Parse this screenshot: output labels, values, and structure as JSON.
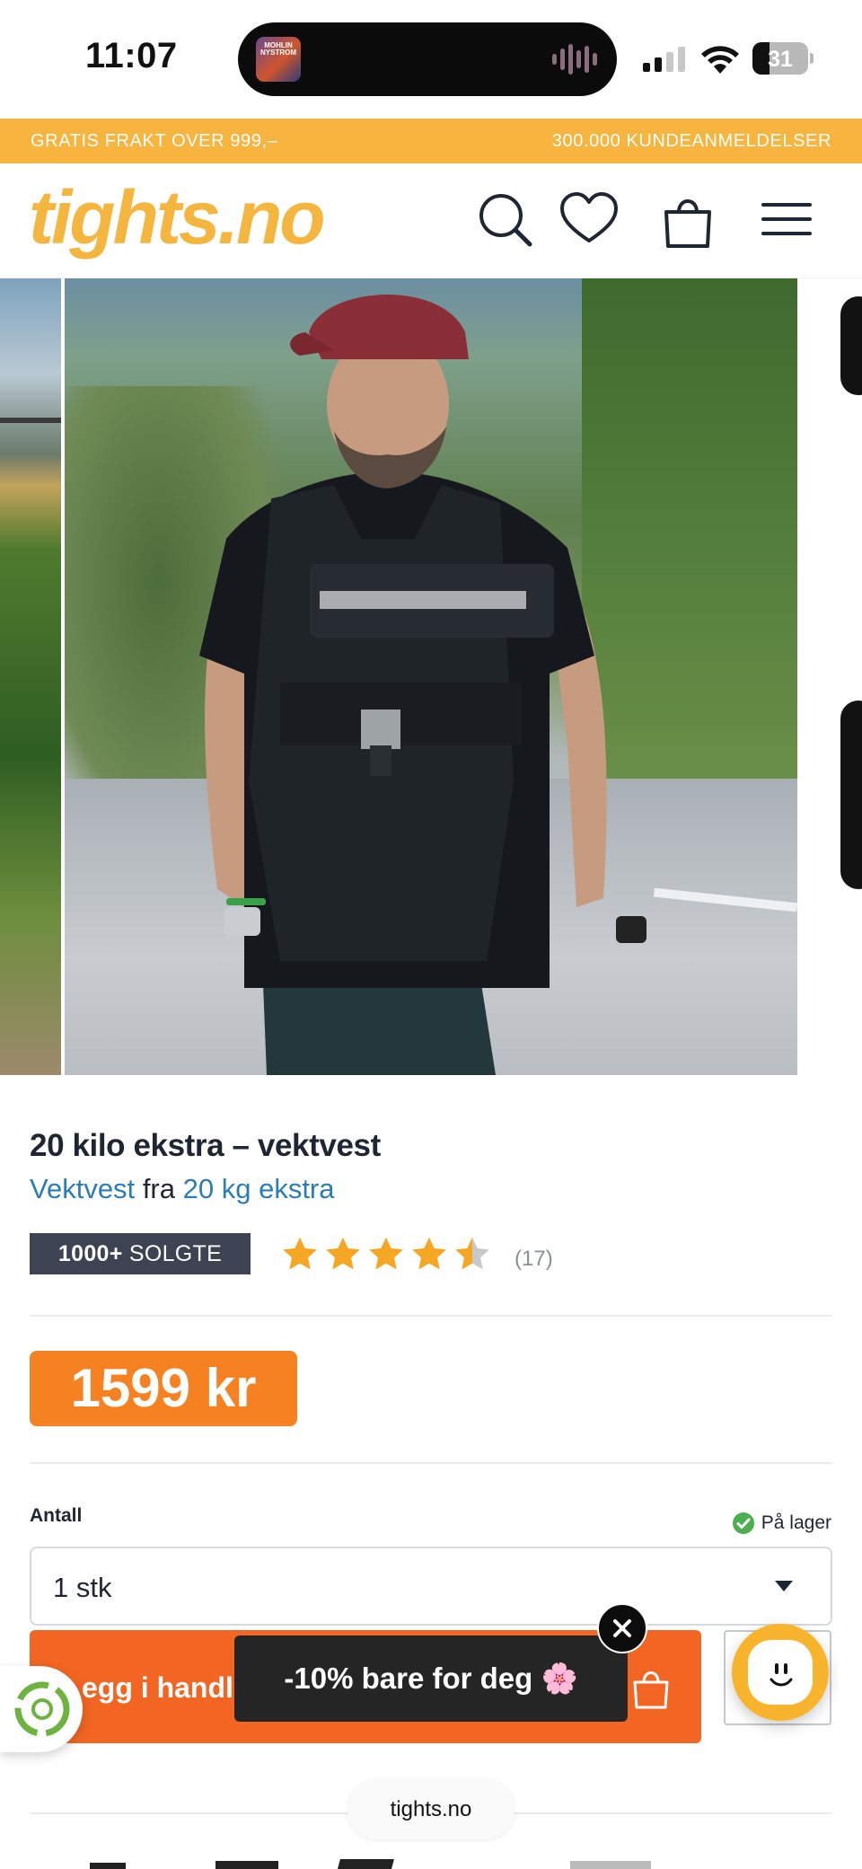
{
  "status_bar": {
    "time": "11:07",
    "now_playing_art_text": "MOHLIN NYSTROM",
    "battery": "31",
    "icons": [
      "signal-icon",
      "wifi-icon",
      "battery-icon",
      "audio-wave-icon"
    ]
  },
  "promo": {
    "left": "GRATIS FRAKT OVER 999,–",
    "right": "300.000 KUNDEANMELDELSER",
    "color": "#f7b540"
  },
  "header": {
    "logo": "tights.no",
    "icons": [
      "search-icon",
      "heart-icon",
      "bag-icon",
      "menu-icon"
    ],
    "brand_color": "#f5b640"
  },
  "product": {
    "title": "20 kilo ekstra – vektvest",
    "category_link": "Vektvest",
    "from_word": "fra",
    "brand_link": "20 kg ekstra",
    "sold_count": "1000+",
    "sold_word": "SOLGTE",
    "rating": 4.5,
    "rating_max": 5,
    "review_count": "(17)",
    "price": "1599 kr",
    "price_color": "#f58120"
  },
  "purchase": {
    "quantity_label": "Antall",
    "stock_status": "På lager",
    "quantity_value": "1 stk",
    "cart_button_label": "egg i handle",
    "cart_color": "#f26522"
  },
  "overlays": {
    "discount_popup": "-10% bare for deg 🌸",
    "domain": "tights.no"
  }
}
